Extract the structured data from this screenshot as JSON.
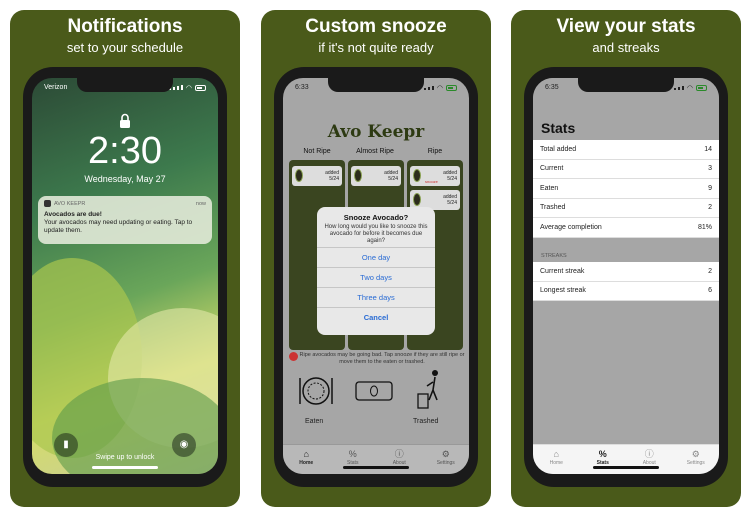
{
  "panels": [
    {
      "title": "Notifications",
      "subtitle": "set to your schedule"
    },
    {
      "title": "Custom snooze",
      "subtitle": "if it's not quite ready"
    },
    {
      "title": "View your stats",
      "subtitle": "and streaks"
    }
  ],
  "lock": {
    "carrier": "Verizon",
    "time": "2:30",
    "date": "Wednesday, May 27",
    "notification": {
      "app": "AVO KEEPR",
      "when": "now",
      "title": "Avocados are due!",
      "body": "Your avocados may need updating or eating. Tap to update them."
    },
    "swipe_text": "Swipe up to unlock"
  },
  "snooze": {
    "status_time": "6:33",
    "app_title": "Avo Keepr",
    "columns": [
      "Not Ripe",
      "Almost Ripe",
      "Ripe"
    ],
    "card_text": "added",
    "card_date": "5/24",
    "snooze_label": "snooze",
    "dialog": {
      "title": "Snooze Avocado?",
      "message": "How long would you like to snooze this avocado for before it becomes due again?",
      "options": [
        "One day",
        "Two days",
        "Three days"
      ],
      "cancel": "Cancel"
    },
    "warning": "Ripe avocados may be going bad. Tap snooze if they are still ripe or move them to the eaten or trashed.",
    "eaten_label": "Eaten",
    "trashed_label": "Trashed",
    "tabs": [
      "Home",
      "Stats",
      "About",
      "Settings"
    ]
  },
  "stats": {
    "status_time": "6:35",
    "heading": "Stats",
    "rows": [
      {
        "label": "Total added",
        "value": "14"
      },
      {
        "label": "Current",
        "value": "3"
      },
      {
        "label": "Eaten",
        "value": "9"
      },
      {
        "label": "Trashed",
        "value": "2"
      },
      {
        "label": "Average completion",
        "value": "81%"
      }
    ],
    "streaks_header": "STREAKS",
    "streaks": [
      {
        "label": "Current streak",
        "value": "2"
      },
      {
        "label": "Longest streak",
        "value": "6"
      }
    ],
    "tabs": [
      "Home",
      "Stats",
      "About",
      "Settings"
    ]
  },
  "colors": {
    "panel_bg": "#4a5a1a",
    "link_blue": "#2a6cd4"
  }
}
